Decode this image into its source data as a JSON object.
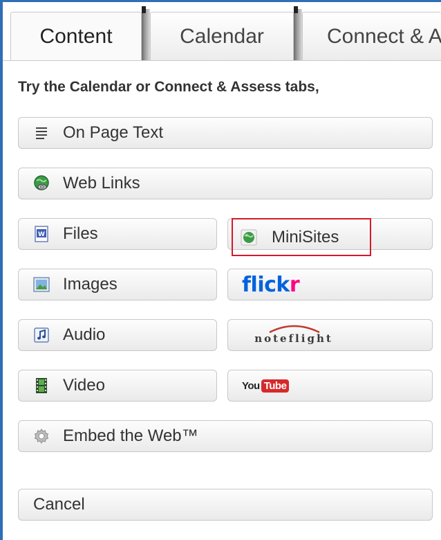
{
  "tabs": [
    {
      "label": "Content",
      "active": true
    },
    {
      "label": "Calendar",
      "active": false
    },
    {
      "label": "Connect & Assess",
      "active": false
    }
  ],
  "instruction": "Try the Calendar or Connect & Assess tabs,",
  "buttons": {
    "on_page_text": {
      "label": "On Page Text",
      "icon": "text-lines-icon"
    },
    "web_links": {
      "label": "Web Links",
      "icon": "globe-link-icon"
    },
    "files": {
      "label": "Files",
      "icon": "word-document-icon"
    },
    "minisites": {
      "label": "MiniSites",
      "icon": "globe-icon"
    },
    "images": {
      "label": "Images",
      "icon": "picture-icon"
    },
    "flickr": {
      "label_blue": "flick",
      "label_pink": "r"
    },
    "audio": {
      "label": "Audio",
      "icon": "music-note-icon"
    },
    "noteflight": {
      "label": "noteflight"
    },
    "video": {
      "label": "Video",
      "icon": "film-strip-icon"
    },
    "youtube": {
      "label_you": "You",
      "label_tube": "Tube"
    },
    "embed": {
      "label": "Embed the Web™",
      "icon": "gear-icon"
    },
    "cancel": {
      "label": "Cancel"
    }
  },
  "colors": {
    "frame": "#2f6fb6",
    "highlight": "#d4182a",
    "flickr_blue": "#0063dc",
    "flickr_pink": "#ff0084",
    "youtube_red": "#d62a2a"
  }
}
